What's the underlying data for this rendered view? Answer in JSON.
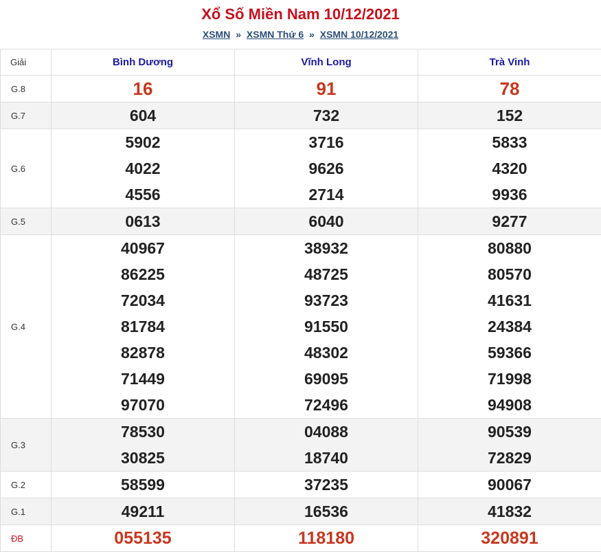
{
  "title": "Xổ Số Miền Nam 10/12/2021",
  "breadcrumb": {
    "items": [
      "XSMN",
      "XSMN Thứ 6",
      "XSMN 10/12/2021"
    ],
    "separator": "»"
  },
  "colors": {
    "title": "#c8101e",
    "link": "#2c4d78",
    "province": "#1a1aa6",
    "special": "#c8371e"
  },
  "table": {
    "label_header": "Giải",
    "provinces": [
      "Bình Dương",
      "Vĩnh Long",
      "Trà Vinh"
    ],
    "rows": [
      {
        "label": "G.8",
        "values": [
          [
            "16"
          ],
          [
            "91"
          ],
          [
            "78"
          ]
        ]
      },
      {
        "label": "G.7",
        "values": [
          [
            "604"
          ],
          [
            "732"
          ],
          [
            "152"
          ]
        ]
      },
      {
        "label": "G.6",
        "values": [
          [
            "5902",
            "4022",
            "4556"
          ],
          [
            "3716",
            "9626",
            "2714"
          ],
          [
            "5833",
            "4320",
            "9936"
          ]
        ]
      },
      {
        "label": "G.5",
        "values": [
          [
            "0613"
          ],
          [
            "6040"
          ],
          [
            "9277"
          ]
        ]
      },
      {
        "label": "G.4",
        "values": [
          [
            "40967",
            "86225",
            "72034",
            "81784",
            "82878",
            "71449",
            "97070"
          ],
          [
            "38932",
            "48725",
            "93723",
            "91550",
            "48302",
            "69095",
            "72496"
          ],
          [
            "80880",
            "80570",
            "41631",
            "24384",
            "59366",
            "71998",
            "94908"
          ]
        ]
      },
      {
        "label": "G.3",
        "values": [
          [
            "78530",
            "30825"
          ],
          [
            "04088",
            "18740"
          ],
          [
            "90539",
            "72829"
          ]
        ]
      },
      {
        "label": "G.2",
        "values": [
          [
            "58599"
          ],
          [
            "37235"
          ],
          [
            "90067"
          ]
        ]
      },
      {
        "label": "G.1",
        "values": [
          [
            "49211"
          ],
          [
            "16536"
          ],
          [
            "41832"
          ]
        ]
      },
      {
        "label": "ĐB",
        "values": [
          [
            "055135"
          ],
          [
            "118180"
          ],
          [
            "320891"
          ]
        ]
      }
    ]
  }
}
